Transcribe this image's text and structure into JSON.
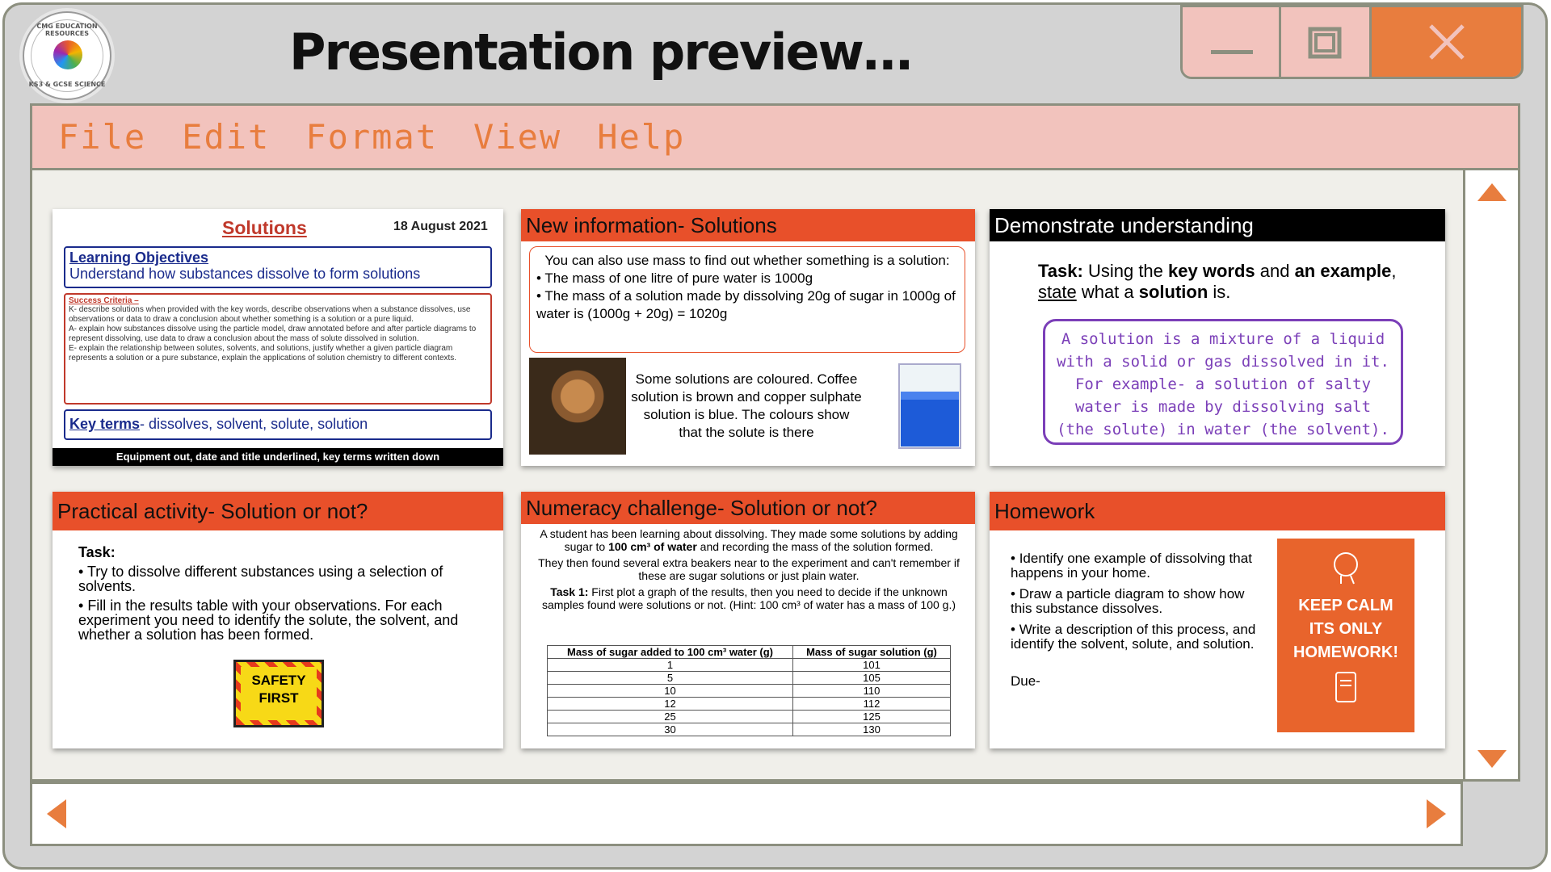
{
  "window": {
    "title": "Presentation preview…",
    "logo_text": "CMG EDUCATION RESOURCES",
    "logo_sub": "KS3 & GCSE SCIENCE"
  },
  "menu": [
    "File",
    "Edit",
    "Format",
    "View",
    "Help"
  ],
  "slide1": {
    "title": "Solutions",
    "date": "18 August 2021",
    "lo_heading": "Learning Objectives",
    "lo_text": "Understand how substances dissolve to form solutions",
    "sc_heading": "Success Criteria –",
    "sc_k": "K- describe solutions when provided with the key words, describe observations when a substance dissolves, use observations or data to draw a conclusion about whether something is a solution or a pure liquid.",
    "sc_a": "A- explain how substances dissolve using the particle model, draw annotated before and after particle diagrams to represent dissolving, use data to draw a conclusion about the mass of solute dissolved in solution.",
    "sc_e": "E- explain the relationship between solutes, solvents, and solutions, justify whether a given particle diagram represents a solution or a pure substance, explain the applications of solution chemistry to different contexts.",
    "kt_label": "Key terms",
    "kt_text": "- dissolves, solvent, solute, solution",
    "footer": "Equipment out, date and title underlined, key terms written down"
  },
  "slide2": {
    "header": "New information- Solutions",
    "intro": "You can also use mass to find out whether something is a solution:",
    "b1": "The mass of one litre of pure water is 1000g",
    "b2": "The mass of a solution made by dissolving 20g of sugar in 1000g of water is (1000g + 20g) = 1020g",
    "body": "Some solutions are coloured. Coffee solution is brown and copper sulphate solution is blue. The colours show that the solute is there"
  },
  "slide3": {
    "header": "Demonstrate understanding",
    "task_label": "Task:",
    "task_a": " Using the ",
    "kw": "key words",
    "task_b": " and ",
    "an": "an example",
    "task_c": ", ",
    "state": "state",
    "task_d": " what a ",
    "sol": "solution",
    "task_e": " is.",
    "answer": "A solution is a mixture of a liquid with a solid or gas dissolved in it. For example- a solution of salty water is made by dissolving salt (the solute) in water (the solvent)."
  },
  "slide4": {
    "header": "Practical activity- Solution or not?",
    "task_label": "Task:",
    "b1": "Try to dissolve different substances using a selection of solvents.",
    "b2": "Fill in the results table with your observations. For each experiment you need to identify the solute, the solvent, and whether a solution has been formed.",
    "sign1": "SAFETY",
    "sign2": "FIRST"
  },
  "slide5": {
    "header": "Numeracy challenge- Solution or not?",
    "p1a": "A student has been learning about dissolving. They made some solutions by adding sugar to ",
    "p1b": "100 cm³ of water",
    "p1c": " and recording the mass of the solution formed.",
    "p2": "They then found several extra beakers near to the experiment and can't remember if these are sugar solutions or just plain water.",
    "p3a": "Task 1:",
    "p3b": " First plot a graph of the results, then you need to decide if the unknown samples found were solutions or not. (Hint: 100 cm³ of water has a mass of 100 g.)",
    "col1": "Mass of sugar added to 100 cm³ water (g)",
    "col2": "Mass of sugar solution (g)",
    "rows": [
      [
        "1",
        "101"
      ],
      [
        "5",
        "105"
      ],
      [
        "10",
        "110"
      ],
      [
        "12",
        "112"
      ],
      [
        "25",
        "125"
      ],
      [
        "30",
        "130"
      ]
    ]
  },
  "slide6": {
    "header": "Homework",
    "b1": "Identify one example of dissolving that happens in your home.",
    "b2": "Draw a particle diagram to show how this substance dissolves.",
    "b3": "Write a description of this process, and identify the solvent, solute, and solution.",
    "due": "Due-",
    "poster": "KEEP CALM ITS ONLY HOMEWORK!"
  },
  "colors": {
    "accent": "#e87d3e",
    "menubar": "#f2c3bd",
    "slide_header": "#e8502a",
    "frame": "#8c8f7f"
  }
}
